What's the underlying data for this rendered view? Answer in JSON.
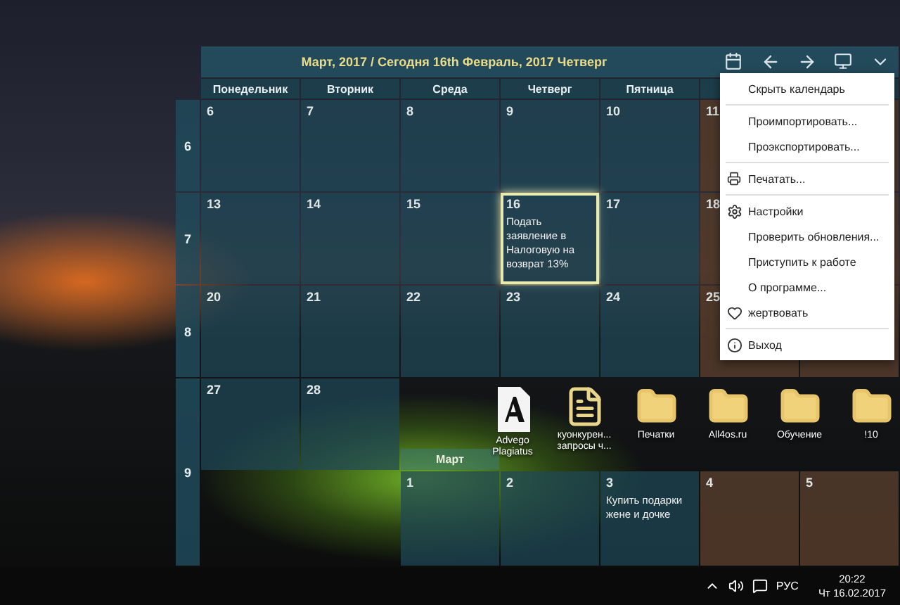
{
  "calendar": {
    "title": "Март, 2017 / Сегодня 16th Февраль, 2017 Четверг",
    "weekdays": [
      "Понедельник",
      "Вторник",
      "Среда",
      "Четверг",
      "Пятница"
    ],
    "weeks": [
      {
        "number": "6",
        "days": [
          {
            "label": "6",
            "kind": "weekday",
            "selected": false
          },
          {
            "label": "7",
            "kind": "weekday",
            "selected": false
          },
          {
            "label": "8",
            "kind": "weekday",
            "selected": false
          },
          {
            "label": "9",
            "kind": "weekday",
            "selected": false
          },
          {
            "label": "10",
            "kind": "weekday",
            "selected": false
          },
          {
            "label": "11",
            "kind": "weekend",
            "selected": false
          }
        ]
      },
      {
        "number": "7",
        "days": [
          {
            "label": "13",
            "kind": "weekday",
            "selected": false
          },
          {
            "label": "14",
            "kind": "weekday",
            "selected": false
          },
          {
            "label": "15",
            "kind": "weekday",
            "selected": false
          },
          {
            "label": "16",
            "kind": "weekday",
            "selected": true,
            "event": "Подать заявление в Налоговую на возврат 13%"
          },
          {
            "label": "17",
            "kind": "weekday",
            "selected": false
          },
          {
            "label": "18",
            "kind": "weekend",
            "selected": false
          }
        ]
      },
      {
        "number": "8",
        "days": [
          {
            "label": "20",
            "kind": "weekday",
            "selected": false
          },
          {
            "label": "21",
            "kind": "weekday",
            "selected": false
          },
          {
            "label": "22",
            "kind": "weekday",
            "selected": false
          },
          {
            "label": "23",
            "kind": "weekday",
            "selected": false
          },
          {
            "label": "24",
            "kind": "weekday",
            "selected": false
          },
          {
            "label": "25",
            "kind": "weekend",
            "selected": false
          }
        ]
      }
    ],
    "last_week": {
      "number": "9",
      "days": [
        {
          "label": "27",
          "kind": "weekday",
          "selected": false
        },
        {
          "label": "28",
          "kind": "weekday",
          "selected": false
        }
      ],
      "next_month": {
        "title": "Март",
        "days": [
          {
            "label": "1",
            "kind": "weekday",
            "selected": false
          },
          {
            "label": "2",
            "kind": "weekday",
            "selected": false
          },
          {
            "label": "3",
            "kind": "weekday",
            "selected": false,
            "event": "Купить подарки жене и дочке"
          },
          {
            "label": "4",
            "kind": "weekend",
            "selected": false
          },
          {
            "label": "5",
            "kind": "weekend",
            "selected": false
          }
        ]
      }
    }
  },
  "menu": {
    "groups": [
      [
        {
          "label": "Скрыть календарь",
          "kind": "plain"
        }
      ],
      [
        {
          "label": "Проимпортировать...",
          "kind": "plain"
        },
        {
          "label": "Проэкспортировать...",
          "kind": "plain"
        }
      ],
      [
        {
          "label": "Печатать...",
          "kind": "print"
        }
      ],
      [
        {
          "label": "Настройки",
          "kind": "settings"
        },
        {
          "label": "Проверить обновления...",
          "kind": "plain"
        },
        {
          "label": "Приступить к работе",
          "kind": "plain"
        },
        {
          "label": "О программе...",
          "kind": "plain"
        },
        {
          "label": "жертвовать",
          "kind": "donate"
        }
      ],
      [
        {
          "label": "Выход",
          "kind": "info"
        }
      ]
    ]
  },
  "desktop_icons": [
    {
      "label": "Advego Plagiatus",
      "kind": "app"
    },
    {
      "label": "куонкурен... запросы ч...",
      "kind": "document"
    },
    {
      "label": "Печатки",
      "kind": "folder"
    },
    {
      "label": "All4os.ru",
      "kind": "folder"
    },
    {
      "label": "Обучение",
      "kind": "folder"
    },
    {
      "label": "!10",
      "kind": "folder"
    }
  ],
  "taskbar": {
    "language": "РУС",
    "time": "20:22",
    "date": "Чт 16.02.2017"
  }
}
